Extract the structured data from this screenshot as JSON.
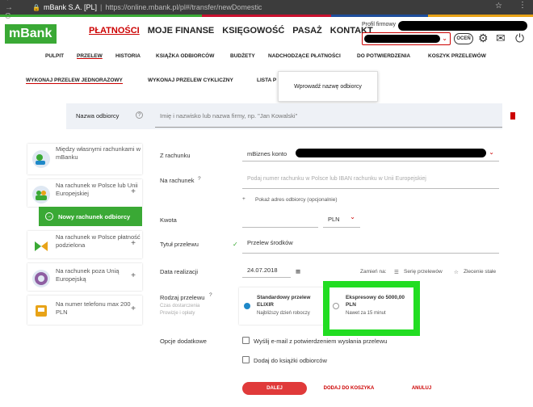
{
  "browser": {
    "nav_glyphs": "← → C",
    "secure_icon": "🔒",
    "site": "mBank S.A. [PL]",
    "separator": "|",
    "url": "https://online.mbank.pl/pl#/transfer/newDomestic",
    "star_glyph": "☆",
    "menu_glyph": "⋮"
  },
  "logo": {
    "text": "mBank"
  },
  "main_nav": [
    "PŁATNOŚCI",
    "MOJE FINANSE",
    "KSIĘGOWOŚĆ",
    "PASAŻ",
    "KONTAKT"
  ],
  "profile": {
    "label": "Profil firmowy",
    "rate_label": "OCEŃ"
  },
  "icons": {
    "chevron": "⌄",
    "settings": "⚙",
    "mail": "✉",
    "power": "⏻",
    "plus": "+",
    "check": "✓",
    "calendar": "▦",
    "list": "☰",
    "star": "☆",
    "help": "?"
  },
  "sub_nav": [
    "PULPIT",
    "PRZELEW",
    "HISTORIA",
    "KSIĄŻKA ODBIORCÓW",
    "BUDŻETY",
    "NADCHODZĄCE PŁATNOŚCI",
    "DO POTWIERDZENIA",
    "KOSZYK PRZELEWÓW"
  ],
  "tabs": [
    "WYKONAJ PRZELEW JEDNORAZOWY",
    "WYKONAJ PRZELEW CYKLICZNY",
    "LISTA P"
  ],
  "tooltip": "Wprowadź nazwę odbiorcy",
  "recipient": {
    "label": "Nazwa odbiorcy",
    "placeholder": "Imię i nazwisko lub nazwa firmy, np. \"Jan Kowalski\""
  },
  "sidebar": [
    {
      "label": "Między własnymi rachunkami w mBanku",
      "plus": ""
    },
    {
      "label": "Na rachunek w Polsce lub Unii Europejskiej",
      "plus": "+"
    },
    {
      "label": "Na rachunek w Polsce płatność podzielona",
      "plus": "+"
    },
    {
      "label": "Na rachunek poza Unią Europejską",
      "plus": "+"
    },
    {
      "label": "Na numer telefonu max 200 PLN",
      "plus": "+"
    }
  ],
  "new_recipient_button": "Nowy rachunek odbiorcy",
  "form": {
    "from_label": "Z rachunku",
    "from_value": "mBiznes konto",
    "to_label": "Na rachunek",
    "to_placeholder": "Podaj numer rachunku w Polsce lub IBAN rachunku w Unii Europejskiej",
    "show_address": "Pokaż adres odbiorcy (opcjonalnie)",
    "amount_label": "Kwota",
    "currency": "PLN",
    "title_label": "Tytuł przelewu",
    "title_value": "Przelew środków",
    "date_label": "Data realizacji",
    "date_value": "24.07.2018",
    "replace_label": "Zamień na:",
    "series_label": "Serię przelewów",
    "standing_label": "Zlecenie stałe",
    "type_label": "Rodzaj przelewu",
    "type_sub": "Czas dostarczenia Prowizje i opłaty",
    "standard": {
      "title": "Standardowy przelew ELIXIR",
      "sub": "Najbliższy dzień roboczy"
    },
    "express": {
      "title": "Ekspresowy do 5000,00 PLN",
      "sub": "Nawet za 15 minut"
    },
    "options_label": "Opcje dodatkowe",
    "option_email": "Wyślij e-mail z potwierdzeniem wysłania przelewu",
    "option_book": "Dodaj do książki odbiorców"
  },
  "buttons": {
    "next": "DALEJ",
    "add_cart": "DODAJ DO KOSZYKA",
    "cancel": "ANULUJ"
  },
  "colors": {
    "brand_green": "#3aa935",
    "accent_red": "#c8102e",
    "highlight": "#22dd22"
  }
}
